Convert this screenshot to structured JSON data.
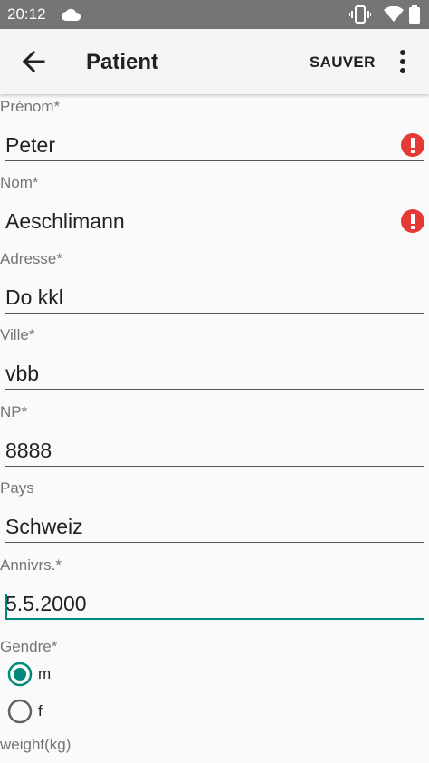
{
  "status_bar": {
    "time": "20:12"
  },
  "app_bar": {
    "title": "Patient",
    "save_label": "SAUVER"
  },
  "form": {
    "fields": [
      {
        "label": "Prénom*",
        "value": "Peter",
        "error": true
      },
      {
        "label": "Nom*",
        "value": "Aeschlimann",
        "error": true
      },
      {
        "label": "Adresse*",
        "value": "Do kkl",
        "error": false
      },
      {
        "label": "Ville*",
        "value": "vbb",
        "error": false
      },
      {
        "label": "NP*",
        "value": "8888",
        "error": false
      },
      {
        "label": "Pays",
        "value": "Schweiz",
        "error": false
      },
      {
        "label": "Annivrs.*",
        "value": "5.5.2000",
        "error": false,
        "focused": true
      }
    ],
    "gender": {
      "label": "Gendre*",
      "options": [
        "m",
        "f"
      ],
      "selected": "m"
    },
    "weight_label": "weight(kg)"
  },
  "colors": {
    "accent": "#00897b",
    "error": "#e53935",
    "status_bar": "#757575"
  }
}
